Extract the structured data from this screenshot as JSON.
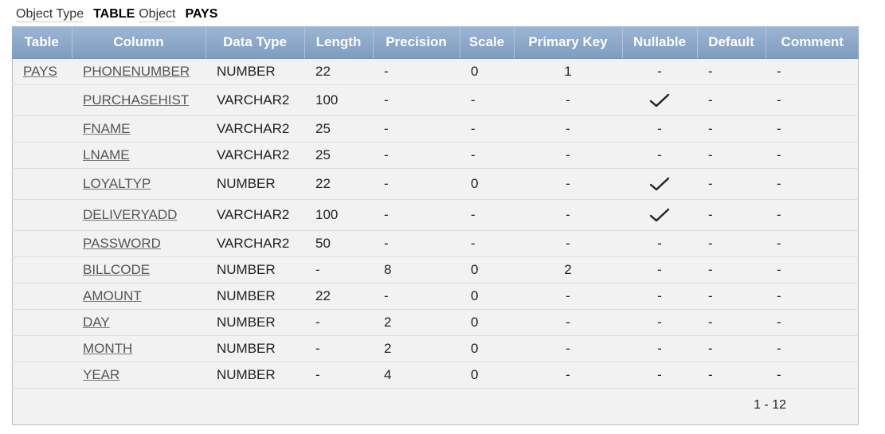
{
  "meta": {
    "object_type_label": "Object Type",
    "object_type_value": "TABLE",
    "object_label": "Object",
    "object_value": "PAYS"
  },
  "table": {
    "headers": [
      "Table",
      "Column",
      "Data Type",
      "Length",
      "Precision",
      "Scale",
      "Primary Key",
      "Nullable",
      "Default",
      "Comment"
    ],
    "rows": [
      {
        "table": "PAYS",
        "column": "PHONENUMBER",
        "type": "NUMBER",
        "length": "22",
        "precision": "-",
        "scale": "0",
        "pk": "1",
        "nullable": false,
        "default": "-",
        "comment": "-"
      },
      {
        "table": "",
        "column": "PURCHASEHIST",
        "type": "VARCHAR2",
        "length": "100",
        "precision": "-",
        "scale": "-",
        "pk": "-",
        "nullable": true,
        "default": "-",
        "comment": "-"
      },
      {
        "table": "",
        "column": "FNAME",
        "type": "VARCHAR2",
        "length": "25",
        "precision": "-",
        "scale": "-",
        "pk": "-",
        "nullable": false,
        "default": "-",
        "comment": "-"
      },
      {
        "table": "",
        "column": "LNAME",
        "type": "VARCHAR2",
        "length": "25",
        "precision": "-",
        "scale": "-",
        "pk": "-",
        "nullable": false,
        "default": "-",
        "comment": "-"
      },
      {
        "table": "",
        "column": "LOYALTYP",
        "type": "NUMBER",
        "length": "22",
        "precision": "-",
        "scale": "0",
        "pk": "-",
        "nullable": true,
        "default": "-",
        "comment": "-"
      },
      {
        "table": "",
        "column": "DELIVERYADD",
        "type": "VARCHAR2",
        "length": "100",
        "precision": "-",
        "scale": "-",
        "pk": "-",
        "nullable": true,
        "default": "-",
        "comment": "-"
      },
      {
        "table": "",
        "column": "PASSWORD",
        "type": "VARCHAR2",
        "length": "50",
        "precision": "-",
        "scale": "-",
        "pk": "-",
        "nullable": false,
        "default": "-",
        "comment": "-"
      },
      {
        "table": "",
        "column": "BILLCODE",
        "type": "NUMBER",
        "length": "-",
        "precision": "8",
        "scale": "0",
        "pk": "2",
        "nullable": false,
        "default": "-",
        "comment": "-"
      },
      {
        "table": "",
        "column": "AMOUNT",
        "type": "NUMBER",
        "length": "22",
        "precision": "-",
        "scale": "0",
        "pk": "-",
        "nullable": false,
        "default": "-",
        "comment": "-"
      },
      {
        "table": "",
        "column": "DAY",
        "type": "NUMBER",
        "length": "-",
        "precision": "2",
        "scale": "0",
        "pk": "-",
        "nullable": false,
        "default": "-",
        "comment": "-"
      },
      {
        "table": "",
        "column": "MONTH",
        "type": "NUMBER",
        "length": "-",
        "precision": "2",
        "scale": "0",
        "pk": "-",
        "nullable": false,
        "default": "-",
        "comment": "-"
      },
      {
        "table": "",
        "column": "YEAR",
        "type": "NUMBER",
        "length": "-",
        "precision": "4",
        "scale": "0",
        "pk": "-",
        "nullable": false,
        "default": "-",
        "comment": "-"
      }
    ],
    "nullable_empty": "-",
    "nullable_icon": "checkmark-icon"
  },
  "pager": {
    "range": "1 - 12"
  }
}
